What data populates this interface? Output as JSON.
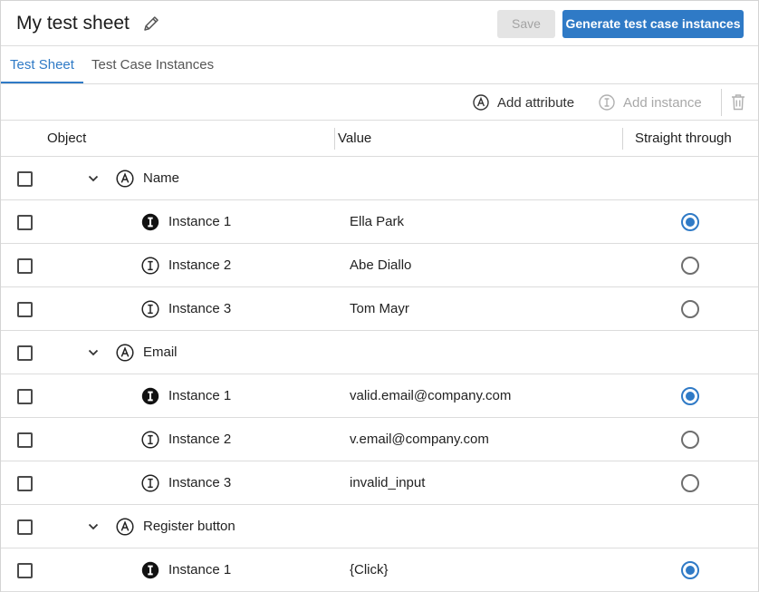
{
  "header": {
    "title": "My test sheet",
    "save_label": "Save",
    "generate_label": "Generate test case instances"
  },
  "tabs": [
    {
      "label": "Test Sheet",
      "active": true
    },
    {
      "label": "Test Case Instances",
      "active": false
    }
  ],
  "toolbar": {
    "add_attribute_label": "Add attribute",
    "add_instance_label": "Add instance"
  },
  "columns": {
    "object": "Object",
    "value": "Value",
    "straight_through": "Straight through"
  },
  "colors": {
    "accent": "#2f7ac6",
    "disabled_bg": "#e4e4e4",
    "disabled_text": "#a3a3a3",
    "border": "#dcdcdc"
  },
  "rows": [
    {
      "type": "attribute",
      "label": "Name"
    },
    {
      "type": "instance",
      "label": "Instance 1",
      "value": "Ella Park",
      "selected": true,
      "filled": true
    },
    {
      "type": "instance",
      "label": "Instance 2",
      "value": "Abe Diallo",
      "selected": false,
      "filled": false
    },
    {
      "type": "instance",
      "label": "Instance 3",
      "value": "Tom Mayr",
      "selected": false,
      "filled": false
    },
    {
      "type": "attribute",
      "label": "Email"
    },
    {
      "type": "instance",
      "label": "Instance 1",
      "value": "valid.email@company.com",
      "selected": true,
      "filled": true
    },
    {
      "type": "instance",
      "label": "Instance 2",
      "value": "v.email@company.com",
      "selected": false,
      "filled": false
    },
    {
      "type": "instance",
      "label": "Instance 3",
      "value": "invalid_input",
      "selected": false,
      "filled": false
    },
    {
      "type": "attribute",
      "label": "Register button"
    },
    {
      "type": "instance",
      "label": "Instance 1",
      "value": "{Click}",
      "selected": true,
      "filled": true
    }
  ]
}
